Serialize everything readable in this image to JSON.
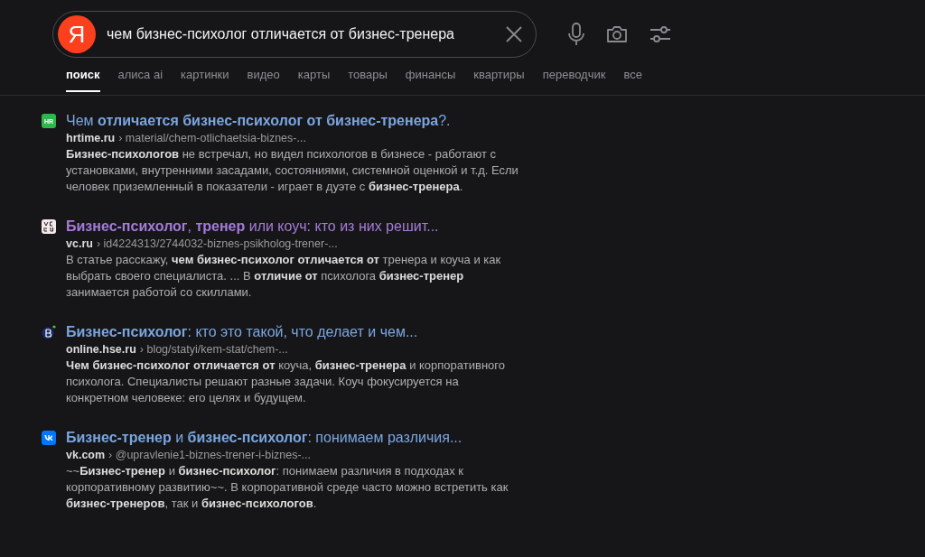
{
  "search": {
    "logo": "Я",
    "value": "чем бизнес-психолог отличается от бизнес-тренера"
  },
  "tabs": [
    {
      "label": "поиск",
      "selected": true
    },
    {
      "label": "алиса ai",
      "selected": false
    },
    {
      "label": "картинки",
      "selected": false
    },
    {
      "label": "видео",
      "selected": false
    },
    {
      "label": "карты",
      "selected": false
    },
    {
      "label": "товары",
      "selected": false
    },
    {
      "label": "финансы",
      "selected": false
    },
    {
      "label": "квартиры",
      "selected": false
    },
    {
      "label": "переводчик",
      "selected": false
    },
    {
      "label": "все",
      "selected": false
    }
  ],
  "results": [
    {
      "favicon": {
        "kind": "hr",
        "text": "HR"
      },
      "visited": false,
      "title": "Чем **отличается бизнес-психолог от бизнес-тренера**?.",
      "site": "hrtime.ru",
      "path": "› material/chem-otlichaetsia-biznes-...",
      "snippet": "**Бизнес-психологов** не встречал, но видел психологов в бизнесе - работают с установками, внутренними засадами, состояниями, системной оценкой и т.д. Если человек приземленный в показатели - играет в дуэте с **бизнес-тренера**."
    },
    {
      "favicon": {
        "kind": "vc"
      },
      "visited": true,
      "title": "**Бизнес-психолог**, **тренер** или коуч: кто из них решит...",
      "site": "vc.ru",
      "path": "› id4224313/2744032-biznes-psikholog-trener-...",
      "snippet": "В статье расскажу, **чем бизнес-психолог отличается от** тренера и коуча и как выбрать своего специалиста. ... В **отличие от** психолога **бизнес-тренер** занимается работой со скиллами."
    },
    {
      "favicon": {
        "kind": "hse"
      },
      "visited": false,
      "title": "**Бизнес-психолог**: кто это такой, что делает и чем...",
      "site": "online.hse.ru",
      "path": "› blog/statyi/kem-stat/chem-...",
      "snippet": "**Чем бизнес-психолог отличается от** коуча, **бизнес-тренера** и корпоративного психолога. Специалисты решают разные задачи. Коуч фокусируется на конкретном человеке: его целях и будущем."
    },
    {
      "favicon": {
        "kind": "vk"
      },
      "visited": false,
      "title": "**Бизнес-тренер** и **бизнес-психолог**: понимаем различия...",
      "site": "vk.com",
      "path": "› @upravlenie1-biznes-trener-i-biznes-...",
      "snippet": "~~**Бизнес-тренер** и **бизнес-психолог**: понимаем различия в подходах к корпоративному развитию~~. В корпоративной среде часто можно встретить как **бизнес-тренеров**, так и **бизнес-психологов**."
    }
  ]
}
